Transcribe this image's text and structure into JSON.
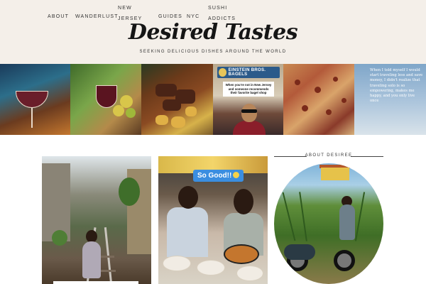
{
  "nav": {
    "about": "ABOUT",
    "wanderlust": "WANDERLUST",
    "new_jersey": "NEW JERSEY",
    "guides": "GUIDES",
    "nyc": "NYC",
    "sushi_addicts": "SUSHI ADDICTS"
  },
  "brand": {
    "logo": "Desired Tastes",
    "tagline": "SEEKING DELICIOUS DISHES AROUND THE WORLD"
  },
  "strip": {
    "bagel_sign": "EINSTEIN BROS. BAGELS",
    "bagel_caption": "When you're not in New Jersey and someone recommends their favorite bagel shop",
    "quote": "When I told myself I would start traveling less and save money, I didn't realize that traveling solo is so empowering, makes me happy, and you only live once"
  },
  "posts": {
    "sogood": "So Good!!"
  },
  "sidebar": {
    "about_title": "ABOUT DESIREE"
  },
  "colors": {
    "header_bg": "#f4efe9",
    "accent_blue": "#3b8ee0"
  }
}
